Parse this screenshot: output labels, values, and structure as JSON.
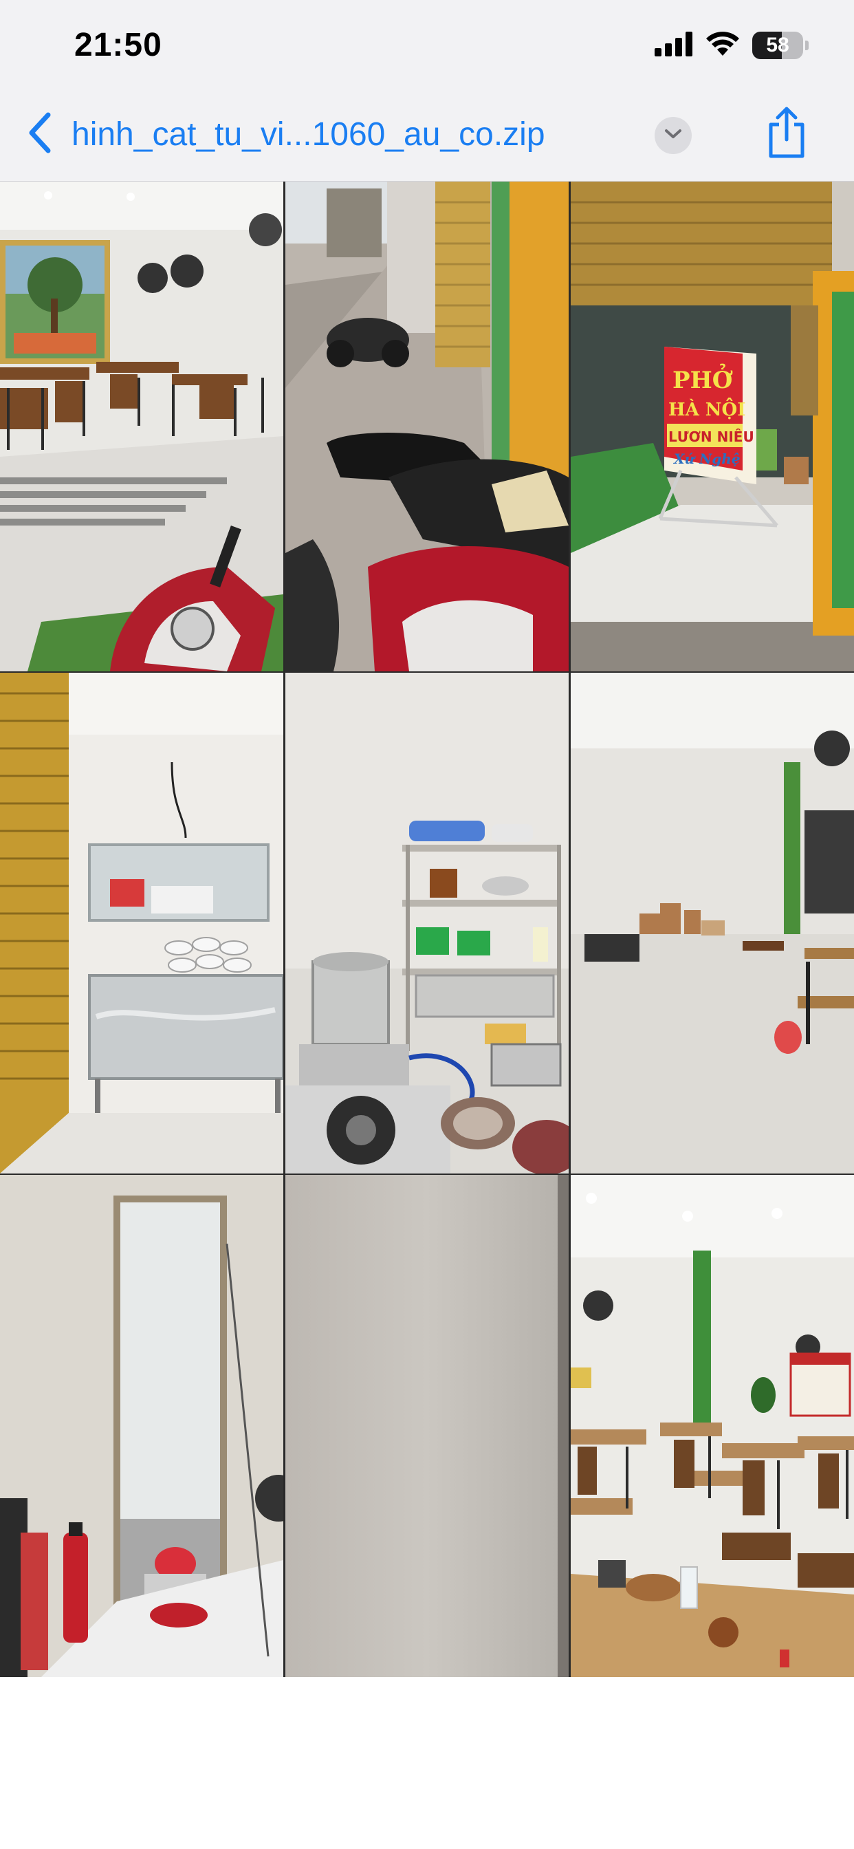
{
  "status_bar": {
    "time": "21:50",
    "battery_level": "58",
    "battery_fraction": 0.58,
    "icons": [
      "cellular-signal-icon",
      "wifi-icon",
      "battery-icon"
    ]
  },
  "nav": {
    "title": "hinh_cat_tu_vi...1060_au_co.zip",
    "back_icon": "chevron-left-icon",
    "dropdown_icon": "chevron-down-icon",
    "share_icon": "share-icon",
    "accent_color": "#1a7ef2"
  },
  "photos": {
    "items": [
      {
        "id": "photo-1",
        "subject": "restaurant-dining-room-with-painting"
      },
      {
        "id": "photo-2",
        "subject": "sidewalk-with-motorbikes"
      },
      {
        "id": "photo-3",
        "subject": "storefront-sign",
        "sign_lines": [
          "PHỞ",
          "HÀ NỘI",
          "LƯƠN NIÊU",
          "Xứ Nghệ"
        ]
      },
      {
        "id": "photo-4",
        "subject": "serving-counter-with-bowls"
      },
      {
        "id": "photo-5",
        "subject": "kitchen-shelves-and-stove"
      },
      {
        "id": "photo-6",
        "subject": "empty-back-room"
      },
      {
        "id": "photo-7",
        "subject": "doorway-with-fire-extinguisher"
      },
      {
        "id": "photo-8",
        "subject": "blank-wall"
      },
      {
        "id": "photo-9",
        "subject": "dining-hall-with-tables"
      }
    ]
  }
}
